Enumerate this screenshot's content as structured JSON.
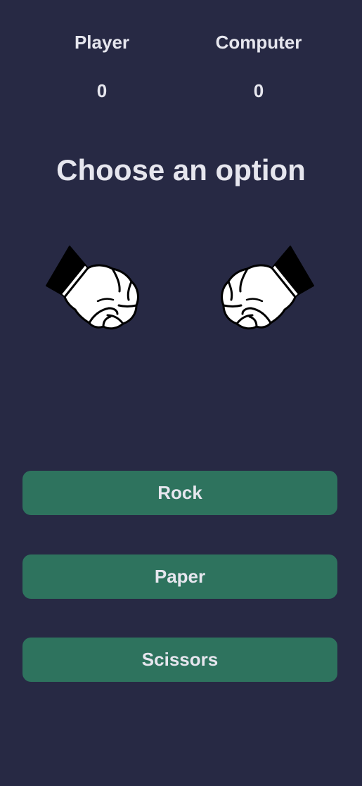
{
  "scoreboard": {
    "player_label": "Player",
    "computer_label": "Computer",
    "player_score": "0",
    "computer_score": "0"
  },
  "prompt": "Choose an option",
  "hands": {
    "player_icon": "fist-icon",
    "computer_icon": "fist-icon"
  },
  "choices": {
    "rock_label": "Rock",
    "paper_label": "Paper",
    "scissors_label": "Scissors"
  },
  "colors": {
    "background": "#272944",
    "button": "#2e735e",
    "text": "#e6e6ee"
  }
}
